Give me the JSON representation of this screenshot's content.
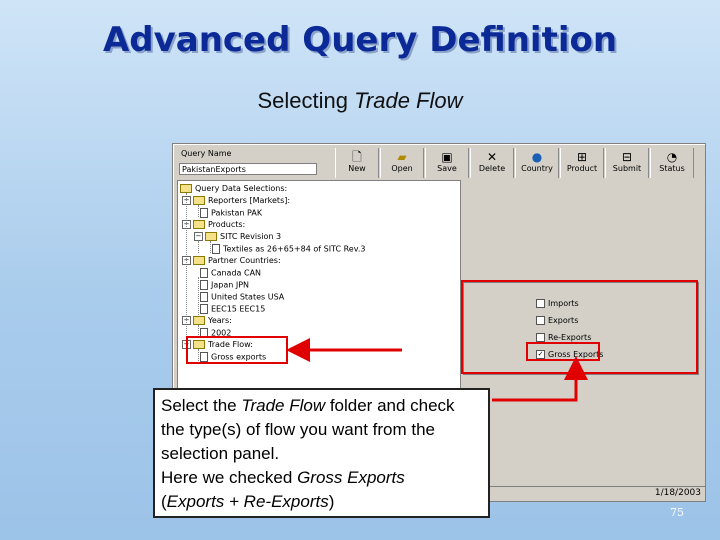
{
  "slide": {
    "title": "Advanced Query Definition",
    "subtitle_prefix": "Selecting ",
    "subtitle_emph": "Trade Flow",
    "page_number": "75"
  },
  "app": {
    "query_name_label": "Query Name",
    "query_name_value": "PakistanExports",
    "toolbar": [
      {
        "label": "New",
        "icon": "new-icon"
      },
      {
        "label": "Open",
        "icon": "open-icon"
      },
      {
        "label": "Save",
        "icon": "save-icon"
      },
      {
        "label": "Delete",
        "icon": "delete-icon"
      },
      {
        "label": "Country",
        "icon": "globe-icon"
      },
      {
        "label": "Product",
        "icon": "product-icon"
      },
      {
        "label": "Submit",
        "icon": "submit-icon"
      },
      {
        "label": "Status",
        "icon": "status-icon"
      }
    ],
    "tree": {
      "root": "Query Data Selections:",
      "reporters_label": "Reporters [Markets]:",
      "reporter_1": "Pakistan PAK",
      "products_label": "Products:",
      "sitc_label": "SITC Revision 3",
      "product_1": "Textiles as 26+65+84 of SITC Rev.3",
      "partners_label": "Partner Countries:",
      "partner_1": "Canada CAN",
      "partner_2": "Japan JPN",
      "partner_3": "United States USA",
      "partner_4": "EEC15 EEC15",
      "years_label": "Years:",
      "year_1": "2002",
      "tradeflow_label": "Trade Flow:",
      "tradeflow_1": "Gross exports"
    },
    "flow_options": [
      {
        "label": "Imports",
        "checked": false
      },
      {
        "label": "Exports",
        "checked": false
      },
      {
        "label": "Re-Exports",
        "checked": false
      },
      {
        "label": "Gross Exports",
        "checked": true
      }
    ],
    "status_date": "1/18/2003"
  },
  "callout": {
    "t1": "Select the ",
    "t1_em": "Trade Flow",
    "t2": " folder and check the type(s) of flow you want from the selection panel.",
    "t3": "Here we checked ",
    "t3_em": "Gross Exports",
    "t4_open": "(",
    "t4_em": "Exports + Re-Exports",
    "t4_close": ")"
  },
  "colors": {
    "highlight": "#e00000",
    "title": "#0c2a97"
  }
}
